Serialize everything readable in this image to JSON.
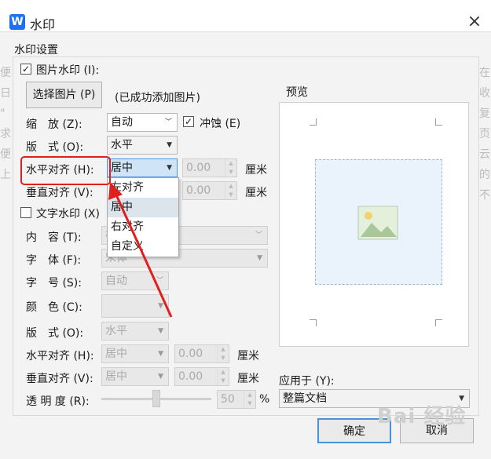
{
  "window": {
    "title": "水印",
    "app_icon": "W"
  },
  "section_title": "水印设置",
  "picture_watermark": {
    "checkbox_label": "图片水印 (I):",
    "checked": true,
    "select_button": "选择图片 (P)",
    "status": "(已成功添加图片)",
    "scale_label": "缩　放 (Z):",
    "scale_value": "自动",
    "erode_label": "冲蚀 (E)",
    "erode_checked": true,
    "layout_label": "版　式 (O):",
    "layout_value": "水平",
    "halign_label": "水平对齐 (H):",
    "halign_value": "居中",
    "halign_offset": "0.00",
    "valign_label": "垂直对齐 (V):",
    "valign_offset": "0.00",
    "unit": "厘米",
    "halign_options": [
      "左对齐",
      "居中",
      "右对齐",
      "自定义"
    ]
  },
  "text_watermark": {
    "checkbox_label": "文字水印 (X)",
    "checked": false,
    "content_label": "内　容 (T):",
    "content_value": "样",
    "font_label": "字　体 (F):",
    "font_value": "宋体",
    "size_label": "字　号 (S):",
    "size_value": "自动",
    "color_label": "颜　色 (C):",
    "layout_label": "版　式 (O):",
    "layout_value": "水平",
    "halign_label": "水平对齐 (H):",
    "halign_value": "居中",
    "halign_offset": "0.00",
    "valign_label": "垂直对齐 (V):",
    "valign_value": "居中",
    "valign_offset": "0.00",
    "unit": "厘米",
    "transparency_label": "透 明 度 (R):",
    "transparency_value": "50",
    "transparency_unit": "%"
  },
  "preview": {
    "label": "预览"
  },
  "apply_to": {
    "label": "应用于 (Y):",
    "value": "整篇文档"
  },
  "buttons": {
    "ok": "确定",
    "cancel": "取消"
  },
  "background_text": {
    "left": "便 日 \" 求 便 上",
    "right": "在 收 复 页 云 的 不"
  },
  "watermark_overlay": "Bai 经验",
  "colors": {
    "highlight": "#e0201c",
    "accent": "#1f6ff0"
  }
}
